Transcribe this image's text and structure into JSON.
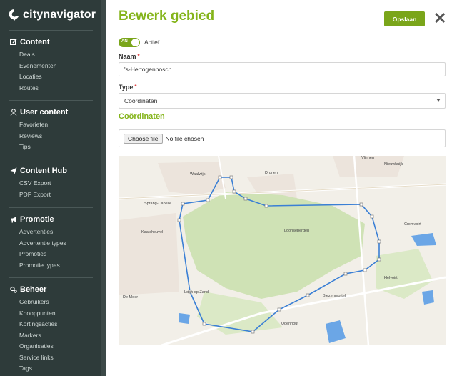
{
  "app": {
    "logo_text": "citynavigator"
  },
  "sidebar": {
    "sections": [
      {
        "title": "Content",
        "icon": "edit-icon",
        "items": [
          "Deals",
          "Evenementen",
          "Locaties",
          "Routes"
        ]
      },
      {
        "title": "User content",
        "icon": "user-icon",
        "items": [
          "Favorieten",
          "Reviews",
          "Tips"
        ]
      },
      {
        "title": "Content Hub",
        "icon": "send-icon",
        "items": [
          "CSV Export",
          "PDF Export"
        ]
      },
      {
        "title": "Promotie",
        "icon": "bullhorn-icon",
        "items": [
          "Advertenties",
          "Advertentie types",
          "Promoties",
          "Promotie types"
        ]
      },
      {
        "title": "Beheer",
        "icon": "gears-icon",
        "items": [
          "Gebruikers",
          "Knooppunten",
          "Kortingsacties",
          "Markers",
          "Organisaties",
          "Service links",
          "Tags"
        ]
      }
    ]
  },
  "form": {
    "title": "Bewerk gebied",
    "save_label": "Opslaan",
    "toggle": {
      "state_label": "AN",
      "label": "Actief",
      "on": true
    },
    "name": {
      "label": "Naam",
      "value": "'s-Hertogenbosch",
      "required_mark": "*"
    },
    "type": {
      "label": "Type",
      "value": "Coordinaten",
      "required_mark": "*"
    },
    "coords_section": "Coördinaten",
    "file": {
      "button_label": "Choose file",
      "status": "No file chosen"
    }
  },
  "map": {
    "place_labels": [
      "Vlijmen",
      "Nieuwkuijk",
      "Waalwijk",
      "Drunen",
      "Sprang-Capelle",
      "Kaatsheuvel",
      "Cromvoirt",
      "Loonsebergen",
      "Loon op Zand",
      "De Moer",
      "Helvoirt",
      "Biezenmortel",
      "Udenhout"
    ],
    "colors": {
      "route": "#3a7fd5",
      "forest": "#cfe2b5",
      "water": "#6ba6e6",
      "base": "#f2efe8",
      "town": "#ece4dc"
    }
  }
}
